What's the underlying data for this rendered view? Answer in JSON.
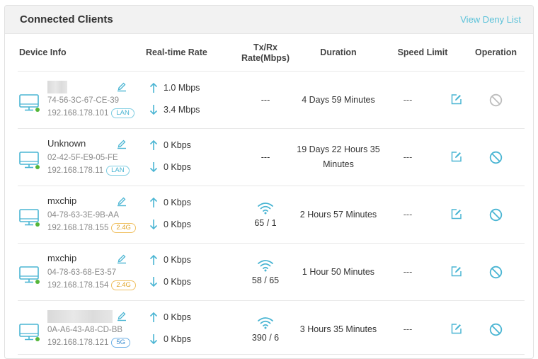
{
  "header": {
    "title": "Connected Clients",
    "deny_link": "View Deny List"
  },
  "columns": {
    "device_info": "Device Info",
    "realtime_rate": "Real-time Rate",
    "txrx_line1": "Tx/Rx",
    "txrx_line2": "Rate(Mbps)",
    "duration": "Duration",
    "speed_limit": "Speed Limit",
    "operation": "Operation"
  },
  "colors": {
    "accent": "#4ab5d3",
    "online_dot": "#55b63a",
    "blocked_grey": "#bdbdbd"
  },
  "clients": [
    {
      "name": "",
      "mac": "74-56-3C-67-CE-39",
      "ip": "192.168.178.101",
      "band": "LAN",
      "up": "1.0 Mbps",
      "down": "3.4 Mbps",
      "txrx": "---",
      "duration_1": "4 Days 59 Minutes",
      "duration_2": "",
      "speed_limit": "---",
      "blocked_icon": "grey"
    },
    {
      "name": "Unknown",
      "mac": "02-42-5F-E9-05-FE",
      "ip": "192.168.178.11",
      "band": "LAN",
      "up": "0 Kbps",
      "down": "0 Kbps",
      "txrx": "---",
      "duration_1": "19 Days 22 Hours 35",
      "duration_2": "Minutes",
      "speed_limit": "---",
      "blocked_icon": "blue"
    },
    {
      "name": "mxchip",
      "mac": "04-78-63-3E-9B-AA",
      "ip": "192.168.178.155",
      "band": "2.4G",
      "up": "0 Kbps",
      "down": "0 Kbps",
      "txrx": "65 / 1",
      "duration_1": "2 Hours 57 Minutes",
      "duration_2": "",
      "speed_limit": "---",
      "blocked_icon": "blue"
    },
    {
      "name": "mxchip",
      "mac": "04-78-63-68-E3-57",
      "ip": "192.168.178.154",
      "band": "2.4G",
      "up": "0 Kbps",
      "down": "0 Kbps",
      "txrx": "58 / 65",
      "duration_1": "1 Hour 50 Minutes",
      "duration_2": "",
      "speed_limit": "---",
      "blocked_icon": "blue"
    },
    {
      "name": "",
      "mac": "0A-A6-43-A8-CD-BB",
      "ip": "192.168.178.121",
      "band": "5G",
      "up": "0 Kbps",
      "down": "0 Kbps",
      "txrx": "390 / 6",
      "duration_1": "3 Hours 35 Minutes",
      "duration_2": "",
      "speed_limit": "---",
      "blocked_icon": "blue"
    }
  ]
}
